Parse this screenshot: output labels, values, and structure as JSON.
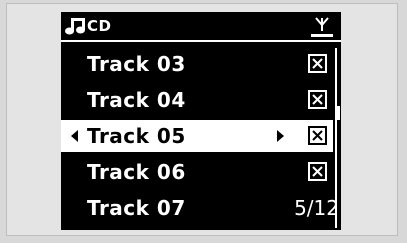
{
  "header": {
    "source_label": "CD",
    "source_icon": "music-note-icon",
    "signal_icon": "antenna-signal-icon"
  },
  "tracks": [
    {
      "label": "Track 03",
      "selected": false,
      "checked": true
    },
    {
      "label": "Track 04",
      "selected": false,
      "checked": true
    },
    {
      "label": "Track 05",
      "selected": true,
      "checked": true
    },
    {
      "label": "Track 06",
      "selected": false,
      "checked": true
    },
    {
      "label": "Track 07",
      "selected": false,
      "checked": false
    }
  ],
  "page_indicator": "5/12",
  "colors": {
    "screen_bg": "#000000",
    "text": "#ffffff",
    "highlight_bg": "#ffffff",
    "highlight_text": "#000000",
    "outer_bg": "#d8d8d8"
  }
}
